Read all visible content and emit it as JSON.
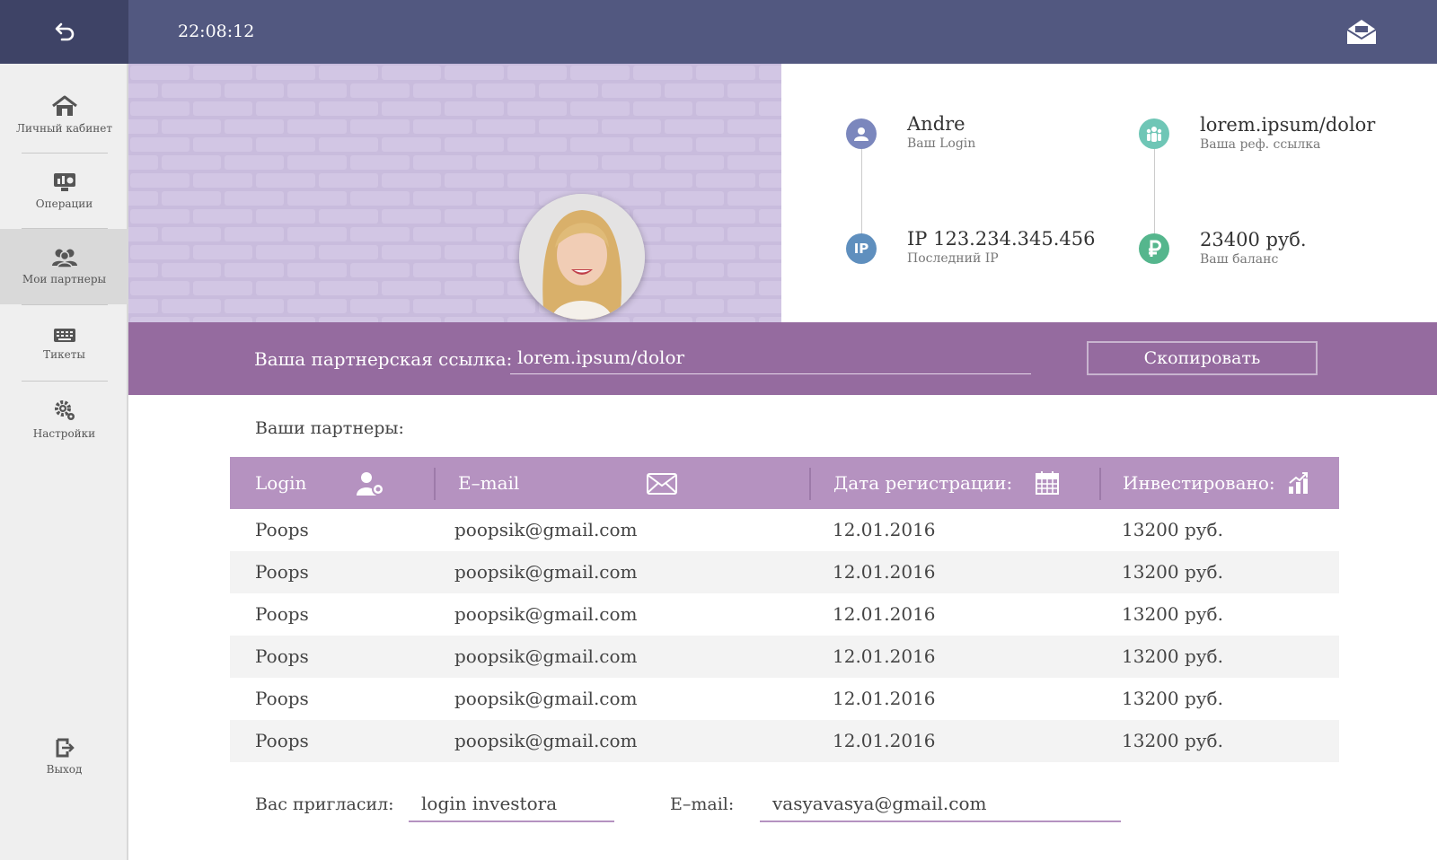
{
  "header": {
    "time": "22:08:12",
    "back_icon": "back-arrow-icon",
    "mail_icon": "envelope-open-icon"
  },
  "sidebar": {
    "items": [
      {
        "label": "Личный кабинет",
        "icon": "home-icon"
      },
      {
        "label": "Операции",
        "icon": "monitor-chart-icon"
      },
      {
        "label": "Мои партнеры",
        "icon": "users-icon",
        "active": true
      },
      {
        "label": "Тикеты",
        "icon": "keyboard-icon"
      },
      {
        "label": "Настройки",
        "icon": "gears-icon"
      }
    ],
    "logout": {
      "label": "Выход",
      "icon": "logout-icon"
    }
  },
  "profile": {
    "login_value": "Andre",
    "login_label": "Ваш Login",
    "ref_value": "lorem.ipsum/dolor",
    "ref_label": "Ваша реф. ссылка",
    "ip_value": "IP 123.234.345.456",
    "ip_label": "Последний IP",
    "balance_value": "23400 руб.",
    "balance_label": "Ваш баланс",
    "ip_badge": "IP"
  },
  "refbar": {
    "label": "Ваша партнерская ссылка:",
    "link": "lorem.ipsum/dolor",
    "copy_label": "Скопировать"
  },
  "partners": {
    "title": "Ваши партнеры:",
    "columns": [
      {
        "label": "Login",
        "icon": "user-icon"
      },
      {
        "label": "E–mail",
        "icon": "envelope-icon"
      },
      {
        "label": "Дата регистрации:",
        "icon": "calendar-icon"
      },
      {
        "label": "Инвестировано:",
        "icon": "growth-chart-icon"
      }
    ],
    "rows": [
      [
        "Poops",
        "poopsik@gmail.com",
        "12.01.2016",
        "13200 руб."
      ],
      [
        "Poops",
        "poopsik@gmail.com",
        "12.01.2016",
        "13200 руб."
      ],
      [
        "Poops",
        "poopsik@gmail.com",
        "12.01.2016",
        "13200 руб."
      ],
      [
        "Poops",
        "poopsik@gmail.com",
        "12.01.2016",
        "13200 руб."
      ],
      [
        "Poops",
        "poopsik@gmail.com",
        "12.01.2016",
        "13200 руб."
      ],
      [
        "Poops",
        "poopsik@gmail.com",
        "12.01.2016",
        "13200 руб."
      ]
    ]
  },
  "invited": {
    "label": "Вас пригласил:",
    "login": "login investora",
    "email_label": "E–mail:",
    "email": "vasyavasya@gmail.com"
  },
  "colors": {
    "topbar": "#525880",
    "accent": "#956b9f",
    "table_header": "#b592c0",
    "login_icon": "#7b87bd",
    "ref_icon": "#6fc6b6",
    "ip_icon": "#5f8fbe",
    "balance_icon": "#55b68d"
  }
}
